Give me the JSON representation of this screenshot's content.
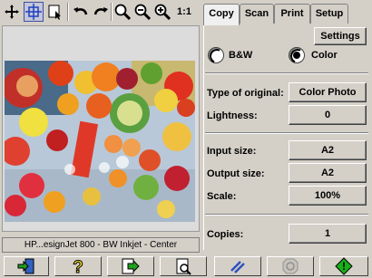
{
  "toolbar": {
    "icons": [
      "move-icon",
      "select-area-icon",
      "selection-pointer-icon",
      "undo-icon",
      "redo-icon",
      "zoom-icon",
      "zoom-out-icon",
      "zoom-in-icon",
      "actual-size-icon"
    ],
    "actual_size_label": "1:1"
  },
  "preview": {
    "status_text": "HP...esignJet 800 - BW Inkjet - Center"
  },
  "tabs": [
    {
      "label": "Copy",
      "active": true
    },
    {
      "label": "Scan",
      "active": false
    },
    {
      "label": "Print",
      "active": false
    },
    {
      "label": "Setup",
      "active": false
    }
  ],
  "copy": {
    "settings_label": "Settings",
    "mode_options": [
      {
        "label": "B&W",
        "selected": false
      },
      {
        "label": "Color",
        "selected": true
      }
    ],
    "fields": {
      "type_of_original": {
        "label": "Type of original:",
        "value": "Color Photo"
      },
      "lightness": {
        "label": "Lightness:",
        "value": "0"
      },
      "input_size": {
        "label": "Input size:",
        "value": "A2"
      },
      "output_size": {
        "label": "Output size:",
        "value": "A2"
      },
      "scale": {
        "label": "Scale:",
        "value": "100%"
      },
      "copies": {
        "label": "Copies:",
        "value": "1"
      }
    }
  },
  "bottom_bar": {
    "buttons": [
      "exit-icon",
      "help-icon",
      "preview-scan-icon",
      "print-preview-icon",
      "cut-icon",
      "stop-icon",
      "start-copy-icon"
    ]
  },
  "colors": {
    "window_bg": "#d4d0c8",
    "active_tab_bg": "#f0f0f0",
    "start_green": "#18b018",
    "help_yellow": "#f0e020"
  }
}
